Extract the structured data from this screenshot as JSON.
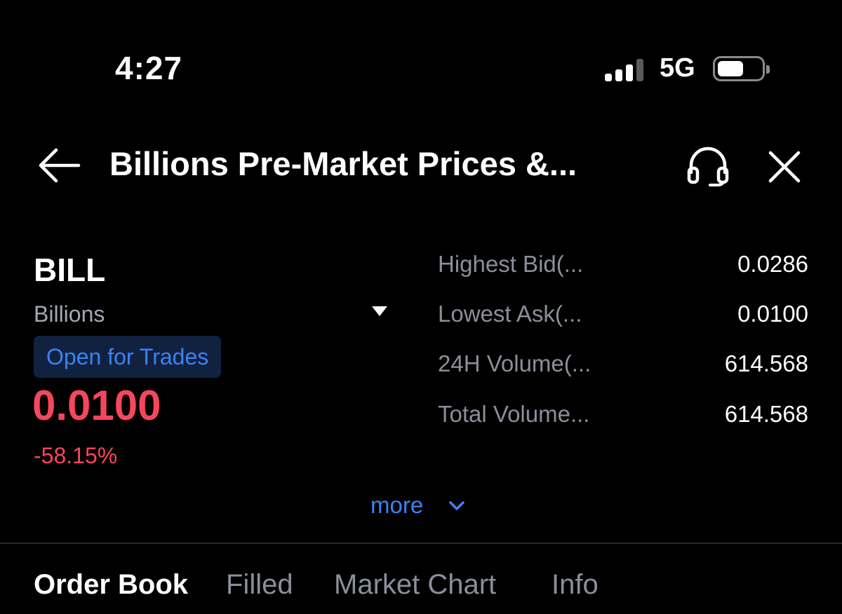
{
  "status_bar": {
    "time": "4:27",
    "network": "5G",
    "signal_bars": 4,
    "battery_level": 0.55
  },
  "header": {
    "title": "Billions Pre-Market Prices &...",
    "back_icon": "arrow-left-icon",
    "support_icon": "headset-icon",
    "close_icon": "close-icon"
  },
  "token": {
    "ticker": "BILL",
    "name": "Billions",
    "status_badge": "Open for Trades",
    "price": "0.0100",
    "change": "-58.15%"
  },
  "stats": [
    {
      "label": "Highest Bid(...",
      "value": "0.0286"
    },
    {
      "label": "Lowest Ask(...",
      "value": "0.0100"
    },
    {
      "label": "24H Volume(...",
      "value": "614.568"
    },
    {
      "label": "Total Volume...",
      "value": "614.568"
    }
  ],
  "more": {
    "label": "more"
  },
  "tabs": [
    {
      "label": "Order Book",
      "active": true
    },
    {
      "label": "Filled",
      "active": false
    },
    {
      "label": "Market Chart",
      "active": false
    },
    {
      "label": "Info",
      "active": false
    }
  ],
  "colors": {
    "background": "#000000",
    "accent_blue": "#3b82f6",
    "negative_red": "#f6465d",
    "muted_text": "#8b8f9a"
  }
}
